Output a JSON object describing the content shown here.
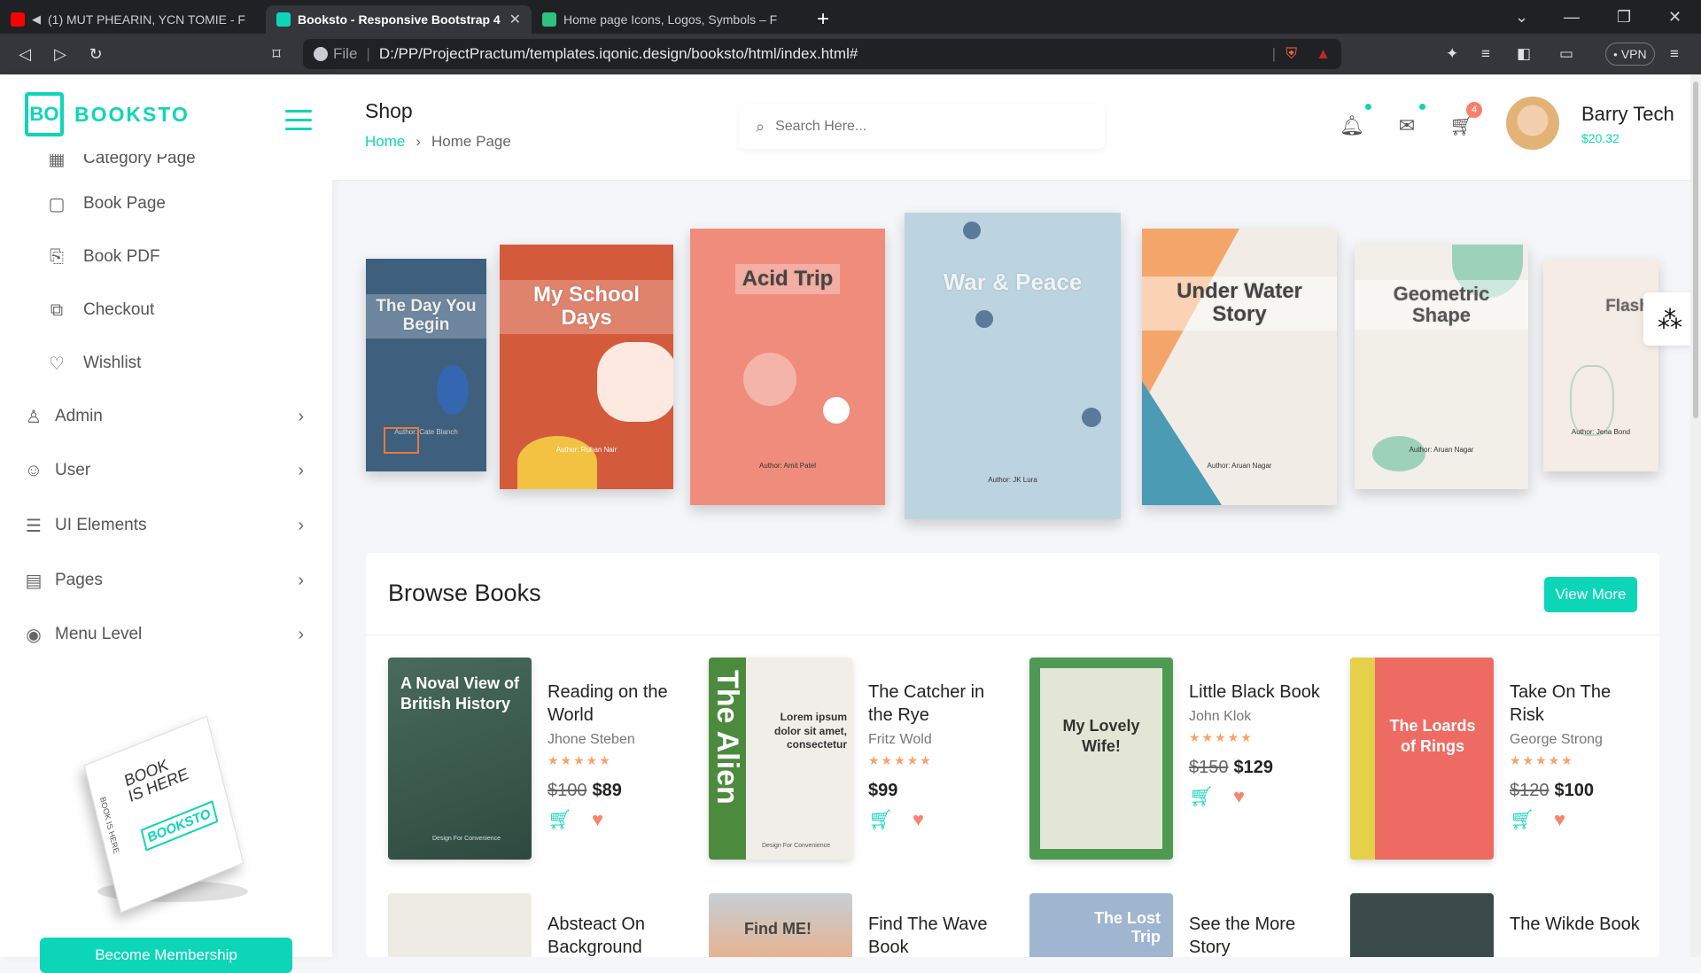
{
  "browser": {
    "tabs": [
      {
        "title": "(1) MUT PHEARIN, YCN TOMIE - F",
        "favicon_color": "#ff0000"
      },
      {
        "title": "Booksto - Responsive Bootstrap 4",
        "favicon_color": "#0dd6b8"
      },
      {
        "title": "Home page Icons, Logos, Symbols – F",
        "favicon_color": "#2ec27e"
      }
    ],
    "new_tab": "+",
    "url_prefix": "File",
    "url": "D:/PP/ProjectPractum/templates.iqonic.design/booksto/html/index.html#",
    "vpn_label": "VPN"
  },
  "app": {
    "logo_mark": "BO",
    "logo_text": "BOOKSTO",
    "accent": "#0dd6b8"
  },
  "sidebar": {
    "items": [
      {
        "label": "Category Page",
        "icon": "grid-icon"
      },
      {
        "label": "Book Page",
        "icon": "book-icon"
      },
      {
        "label": "Book PDF",
        "icon": "pdf-icon"
      },
      {
        "label": "Checkout",
        "icon": "checkout-icon"
      },
      {
        "label": "Wishlist",
        "icon": "heart-icon"
      }
    ],
    "groups": [
      {
        "label": "Admin",
        "icon": "admin-icon"
      },
      {
        "label": "User",
        "icon": "user-icon"
      },
      {
        "label": "UI Elements",
        "icon": "ui-elements-icon"
      },
      {
        "label": "Pages",
        "icon": "pages-icon"
      },
      {
        "label": "Menu Level",
        "icon": "menu-level-icon"
      }
    ],
    "promo_line1": "BOOK",
    "promo_line2": "IS HERE",
    "promo_logo": "BOOKSTO",
    "promo_spine": "BOOK IS HERE",
    "member_button": "Become Membership"
  },
  "header": {
    "title": "Shop",
    "breadcrumb_home": "Home",
    "breadcrumb_sep": "›",
    "breadcrumb_current": "Home Page",
    "search_placeholder": "Search Here...",
    "cart_count": "4",
    "user_name": "Barry Tech",
    "user_balance": "$20.32"
  },
  "carousel": [
    {
      "title": "The Day You Begin",
      "color": "#3f5f7e",
      "author": "Author: Cate Blanch"
    },
    {
      "title": "My School Days",
      "color": "#d45a3c",
      "author": "Author: Ruhan Nair"
    },
    {
      "title": "Acid Trip",
      "color": "#f08c7c",
      "author": "Author: Amit Patel"
    },
    {
      "title": "War & Peace",
      "color": "#bcd4e0",
      "author": "Author: JK Lura"
    },
    {
      "title": "Under Water Story",
      "color": "#f1ede6",
      "author": "Author: Aruan Nagar"
    },
    {
      "title": "Geometric Shape",
      "color": "#f2efe9",
      "author": "Author: Aruan Nagar"
    },
    {
      "title": "Flash",
      "color": "#f5ece6",
      "author": "Author: Jena Bond"
    }
  ],
  "browse": {
    "title": "Browse Books",
    "view_more": "View More",
    "books": [
      {
        "cover_text": "A Noval View of British History",
        "cover_color": "#3b5a4d",
        "title": "Reading on the World",
        "author": "Jhone Steben",
        "old_price": "$100",
        "price": "$89",
        "stars": "★★★★★"
      },
      {
        "cover_text": "The Alien",
        "cover_color": "#4c8a3e",
        "title": "The Catcher in the Rye",
        "author": "Fritz Wold",
        "old_price": "",
        "price": "$99",
        "stars": "★★★★★"
      },
      {
        "cover_text": "My Lovely Wife!",
        "cover_color": "#4f9a52",
        "title": "Little Black Book",
        "author": "John Klok",
        "old_price": "$150",
        "price": "$129",
        "stars": "★★★★★"
      },
      {
        "cover_text": "The Loards of Rings",
        "cover_color": "#ee6b63",
        "title": "Take On The Risk",
        "author": "George Strong",
        "old_price": "$120",
        "price": "$100",
        "stars": "★★★★★"
      }
    ],
    "alien_side_text": "Lorem ipsum dolor sit amet, consectetur",
    "cover_small": "Design For Convenience",
    "row2": [
      {
        "title": "Absteact On Background",
        "cover_color": "#eeeae4",
        "cover_text": ""
      },
      {
        "title": "Find The Wave Book",
        "cover_color": "#e8b08a",
        "cover_text": "Find ME!"
      },
      {
        "title": "See the More Story",
        "cover_color": "#9fb5d0",
        "cover_text": "The Lost Trip"
      },
      {
        "title": "The Wikde Book",
        "cover_color": "#3b4a4a",
        "cover_text": ""
      }
    ]
  }
}
